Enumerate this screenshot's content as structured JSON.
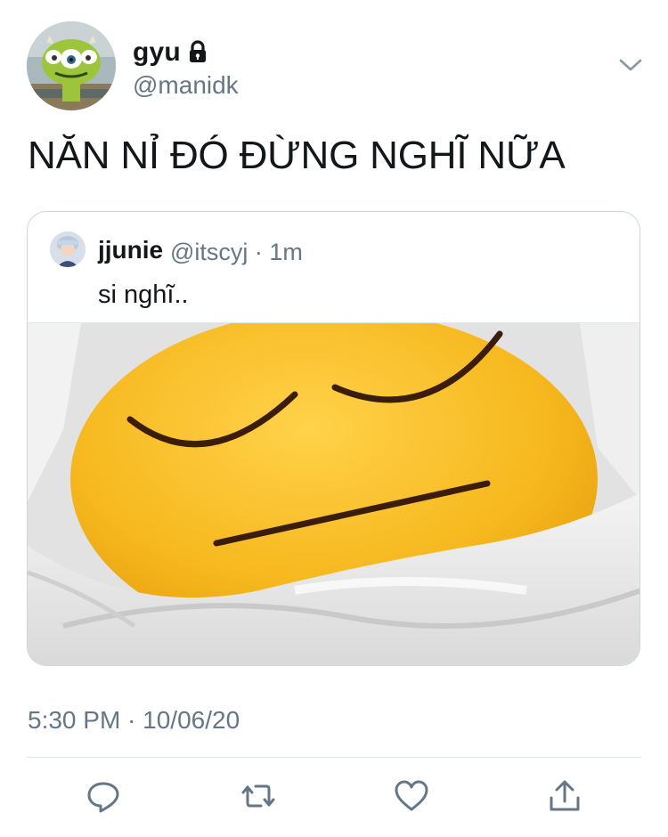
{
  "author": {
    "display_name": "gyu",
    "handle": "@manidk",
    "avatar_icon": "avatar-image",
    "protected_icon": "lock-icon"
  },
  "tweet": {
    "text": "NĂN NỈ ĐÓ ĐỪNG NGHĨ NỮA",
    "timestamp": "5:30 PM · 10/06/20"
  },
  "quoted_tweet": {
    "display_name": "jjunie",
    "meta": "@itscyj · 1m",
    "text": "si nghĩ..",
    "media_icon": "sleepy-emoji-image"
  },
  "actions": [
    {
      "icon": "reply-icon"
    },
    {
      "icon": "retweet-icon"
    },
    {
      "icon": "like-icon"
    },
    {
      "icon": "share-icon"
    }
  ],
  "colors": {
    "primary_text": "#14171a",
    "secondary_text": "#657786",
    "border": "#ccd6dd",
    "icon": "#657786"
  }
}
